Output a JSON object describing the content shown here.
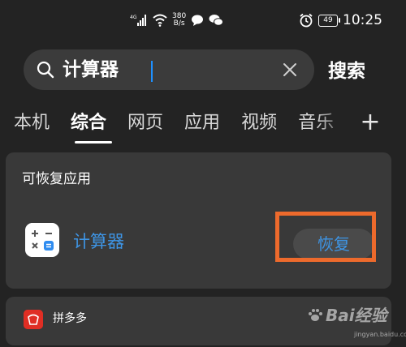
{
  "status_bar": {
    "signal_label": "4G",
    "net_speed_value": "380",
    "net_speed_unit": "B/s",
    "battery": "49",
    "time": "10:25"
  },
  "search": {
    "query": "计算器",
    "button_label": "搜索"
  },
  "tabs": [
    {
      "label": "本机",
      "active": false
    },
    {
      "label": "综合",
      "active": true
    },
    {
      "label": "网页",
      "active": false
    },
    {
      "label": "应用",
      "active": false
    },
    {
      "label": "视频",
      "active": false
    },
    {
      "label": "音乐",
      "active": false
    }
  ],
  "tab_add_label": "+",
  "recoverable": {
    "title": "可恢复应用",
    "app_name": "计算器",
    "restore_label": "恢复"
  },
  "next_result": {
    "app_name": "拼多多"
  },
  "watermark": {
    "text": "Bai经验",
    "sub": "jingyan.baidu.com"
  },
  "colors": {
    "background": "#232323",
    "card": "#393939",
    "accent_blue": "#3e95e5",
    "highlight_orange": "#ed6a2c"
  }
}
